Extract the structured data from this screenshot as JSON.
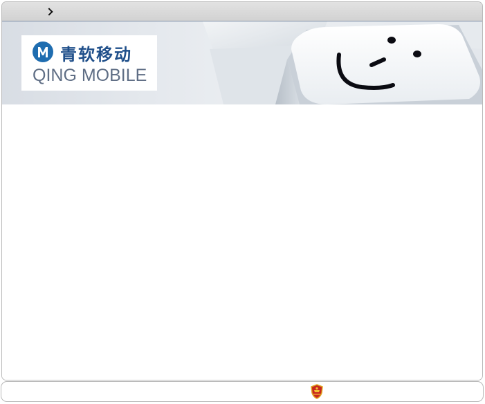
{
  "topbar": {
    "breadcrumb_text": "",
    "chevron_icon": "chevron-right-icon"
  },
  "banner": {
    "logo": {
      "mark_letter": "M",
      "name_cn": "青软移动",
      "name_en": "QING MOBILE",
      "brand_color": "#1f6db0"
    },
    "image": "smiley-keyboard-key"
  },
  "content": {},
  "footer": {
    "emblem_icon": "national-emblem-icon"
  },
  "colors": {
    "topbar": "#d6d6d6",
    "border": "#b9b9b9",
    "logo_text_cn": "#1f4f8a",
    "logo_text_en": "#5f6e85"
  }
}
